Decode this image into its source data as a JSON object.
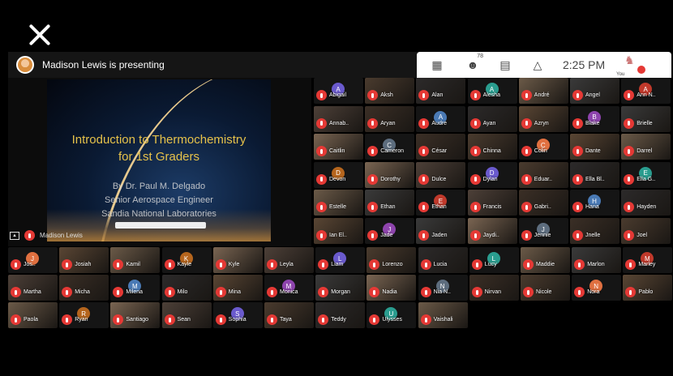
{
  "presenter": {
    "text": "Madison Lewis is presenting"
  },
  "toolbar": {
    "participants_count": "78",
    "time": "2:25 PM",
    "you_label": "You"
  },
  "slide": {
    "title_line1": "Introduction to Thermochemistry",
    "title_line2": "for 1st Graders",
    "author_line1": "By Dr. Paul M. Delgado",
    "author_line2": "Senior Aerospace Engineer",
    "author_line3": "Sandia National Laboratories"
  },
  "screen_owner": "Madison Lewis",
  "colors": {
    "mic_off": "#e53935",
    "tile_dark": "#2d2620",
    "tile_mid": "#3d3328"
  },
  "participants_right": [
    [
      "Abigail",
      "Aksh",
      "Alan",
      "Alesha",
      "André",
      "Angel",
      "Ann N.."
    ],
    [
      "Annab..",
      "Aryan",
      "Audre",
      "Ayan",
      "Azryn",
      "Blake",
      "Brielle"
    ],
    [
      "Caitlin",
      "Cameron",
      "César",
      "Chinna",
      "Colin",
      "Dante",
      "Darrel"
    ],
    [
      "Devon",
      "Dorothy",
      "Dulce",
      "Dylan",
      "Eduar..",
      "Ella Bl..",
      "Ella G.."
    ],
    [
      "Estelle",
      "Ethan",
      "Ethan",
      "Francis",
      "Gabri..",
      "Hana",
      "Hayden"
    ],
    [
      "Ian El..",
      "Jade",
      "Jaden",
      "Jaydi..",
      "Jennie",
      "Jnelle",
      "Joel"
    ]
  ],
  "participants_bottom": [
    [
      "Jos..",
      "Josiah",
      "Kamil",
      "Kayle",
      "Kyle",
      "Leyla",
      "Liam",
      "Lorenzo",
      "Lucia",
      "Lucy",
      "Maddie",
      "Marlon",
      "Marley"
    ],
    [
      "Martha",
      "Micha",
      "Milena",
      "Milo",
      "Mina",
      "Monica",
      "Morgan",
      "Nadia",
      "Nia N..",
      "Nirvan",
      "Nicole",
      "Nora",
      "Pablo"
    ],
    [
      "Paola",
      "Ryan",
      "Santiago",
      "Sean",
      "Sophia",
      "Taya",
      "Teddy",
      "Ulysses",
      "Vaishali"
    ]
  ]
}
